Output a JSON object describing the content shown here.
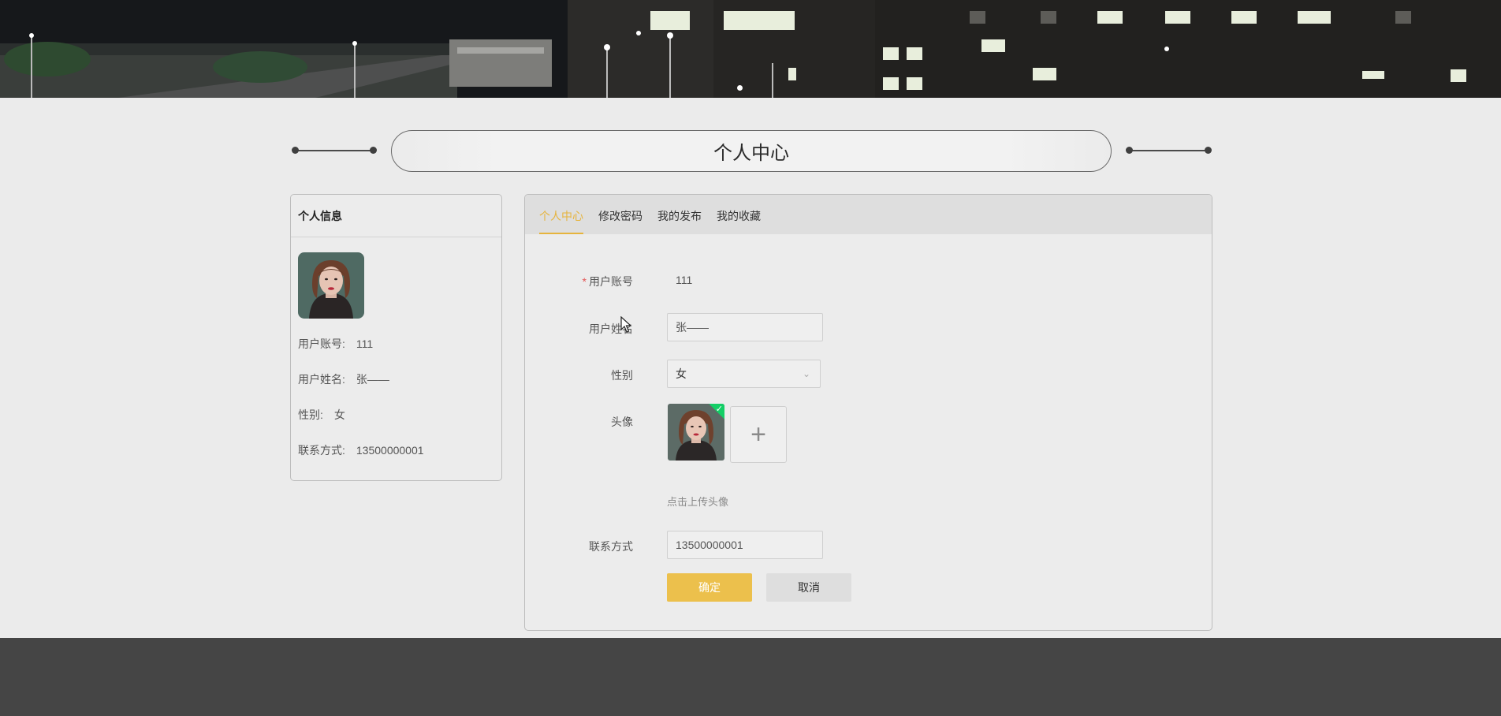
{
  "page_title": "个人中心",
  "sidebar_card": {
    "heading": "个人信息",
    "rows": [
      {
        "label": "用户账号:",
        "value": "111"
      },
      {
        "label": "用户姓名:",
        "value": "张——"
      },
      {
        "label": "性别:",
        "value": "女"
      },
      {
        "label": "联系方式:",
        "value": "13500000001"
      }
    ]
  },
  "tabs": [
    {
      "label": "个人中心",
      "active": true
    },
    {
      "label": "修改密码",
      "active": false
    },
    {
      "label": "我的发布",
      "active": false
    },
    {
      "label": "我的收藏",
      "active": false
    }
  ],
  "form": {
    "account_label": "用户账号",
    "account_value": "111",
    "name_label": "用户姓名",
    "name_value": "张——",
    "gender_label": "性别",
    "gender_value": "女",
    "avatar_label": "头像",
    "upload_hint": "点击上传头像",
    "phone_label": "联系方式",
    "phone_value": "13500000001",
    "confirm_label": "确定",
    "cancel_label": "取消"
  },
  "colors": {
    "accent": "#e6b43c",
    "confirm_button": "#ecc04c",
    "required_star": "#e45656",
    "upload_success": "#13ce66",
    "footer": "#454545"
  }
}
